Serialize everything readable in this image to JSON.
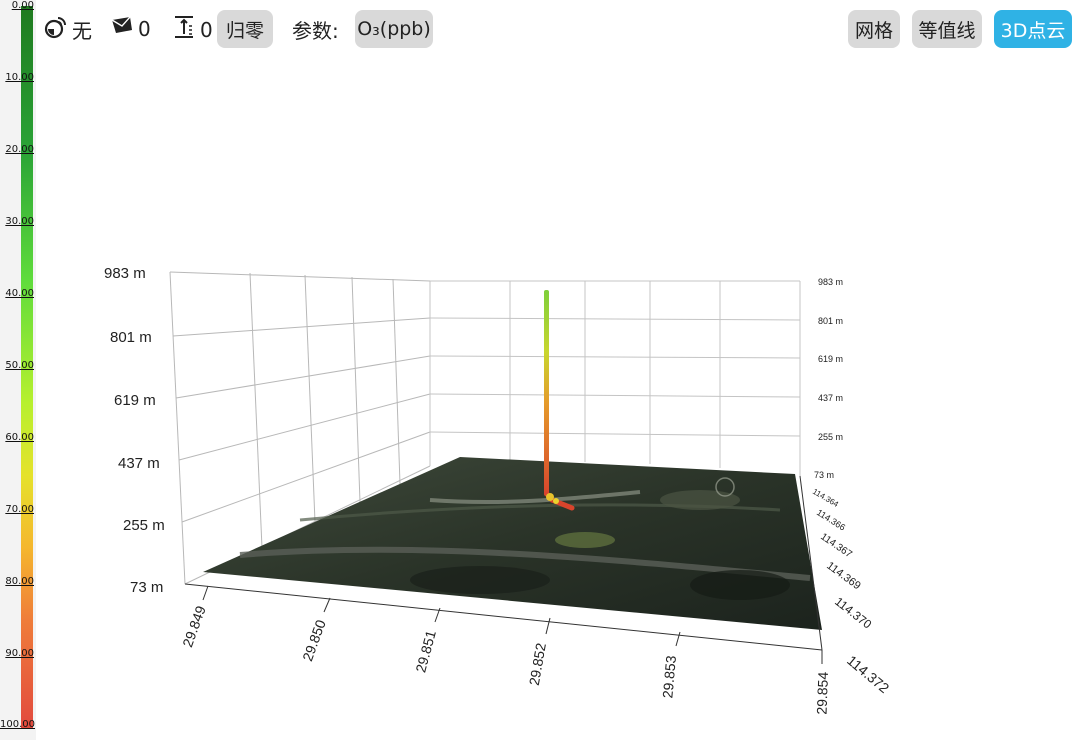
{
  "legend": {
    "ticks": [
      "0.00",
      "10.00",
      "20.00",
      "30.00",
      "40.00",
      "50.00",
      "60.00",
      "70.00",
      "80.00",
      "90.00",
      "100.00"
    ]
  },
  "toolbar": {
    "signal_value": "无",
    "message_count": "0",
    "height_count": "0",
    "reset_label": "归零",
    "param_label": "参数:",
    "param_value": "O₃(ppb)",
    "grid_label": "网格",
    "contour_label": "等值线",
    "pointcloud_label": "3D点云"
  },
  "plot": {
    "altitude_left": [
      "983 m",
      "801 m",
      "619 m",
      "437 m",
      "255 m",
      "73 m"
    ],
    "altitude_right": [
      "983 m",
      "801 m",
      "619 m",
      "437 m",
      "255 m",
      "73 m"
    ],
    "latitude": [
      "29.849",
      "29.850",
      "29.851",
      "29.852",
      "29.853",
      "29.854"
    ],
    "longitude": [
      "114.364",
      "114.366",
      "114.367",
      "114.369",
      "114.370",
      "114.372"
    ]
  }
}
